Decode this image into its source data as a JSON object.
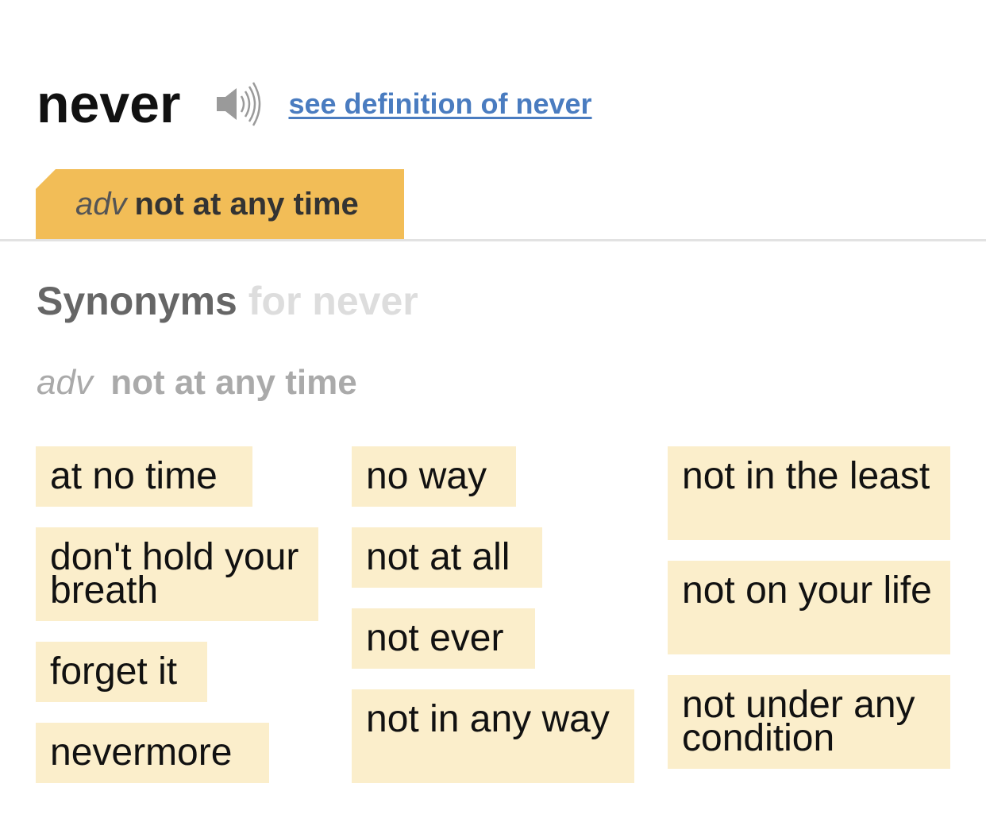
{
  "header": {
    "word": "never",
    "audio_icon": "speaker-icon",
    "definition_link": "see definition of never"
  },
  "tab": {
    "pos": "adv",
    "sense": "not at any time"
  },
  "synonyms_heading": {
    "main": "Synonyms",
    "for": "for never"
  },
  "sense_label": {
    "pos": "adv",
    "sense": "not at any time"
  },
  "colors": {
    "tab_bg": "#f2bd57",
    "chip_bg": "#fbeecb",
    "link": "#4a7cc0"
  },
  "synonyms": [
    [
      "at no time",
      "don't hold your breath",
      "forget it",
      "nevermore"
    ],
    [
      "no way",
      "not at all",
      "not ever",
      "not in any way"
    ],
    [
      "not in the least",
      "not on your life",
      "not under any condition"
    ]
  ]
}
